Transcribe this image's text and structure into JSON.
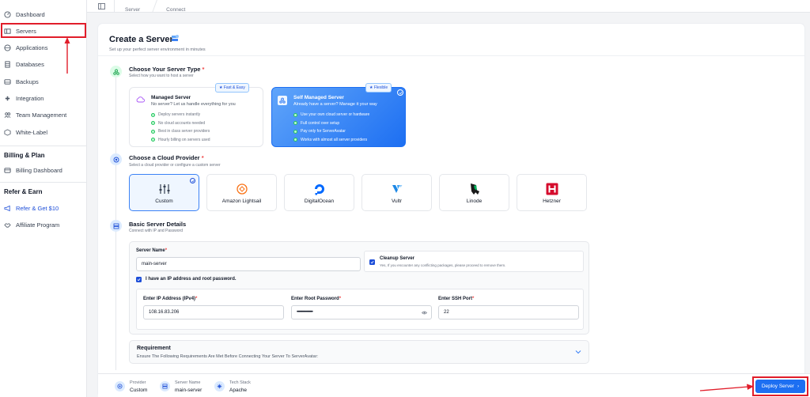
{
  "sidebar": {
    "items": [
      {
        "label": "Dashboard",
        "icon": "dashboard-icon"
      },
      {
        "label": "Servers",
        "icon": "server-icon"
      },
      {
        "label": "Applications",
        "icon": "globe-icon"
      },
      {
        "label": "Databases",
        "icon": "database-icon"
      },
      {
        "label": "Backups",
        "icon": "backup-icon"
      },
      {
        "label": "Integration",
        "icon": "integration-icon"
      },
      {
        "label": "Team Management",
        "icon": "team-icon"
      },
      {
        "label": "White-Label",
        "icon": "whitelabel-icon"
      }
    ],
    "billing_heading": "Billing & Plan",
    "billing_dashboard": "Billing Dashboard",
    "refer_heading": "Refer & Earn",
    "refer_get": "Refer & Get $10",
    "affiliate": "Affiliate Program"
  },
  "breadcrumb": {
    "server": "Server",
    "connect": "Connect"
  },
  "page": {
    "title": "Create a Server",
    "subtitle": "Set up your perfect server environment in minutes"
  },
  "step1": {
    "title": "Choose Your Server Type",
    "subtitle": "Select how you want to host a server",
    "managed": {
      "badge": "★ Fast & Easy",
      "title": "Managed Server",
      "desc": "No server? Let us handle everything for you",
      "features": [
        "Deploy servers instantly",
        "No cloud accounts needed",
        "Best in class server providers",
        "Hourly billing on servers used"
      ]
    },
    "self": {
      "badge": "★ Flexible",
      "title": "Self Managed Server",
      "desc": "Already have a server? Manage it your way",
      "features": [
        "Use your own cloud server or hardware",
        "Full control over setup",
        "Pay only for ServerAvatar",
        "Works with almost all server providers"
      ]
    }
  },
  "step2": {
    "title": "Choose a Cloud Provider",
    "subtitle": "Select a cloud provider or configure a custom server",
    "providers": [
      "Custom",
      "Amazon Lightsail",
      "DigitalOcean",
      "Vultr",
      "Linode",
      "Hetzner"
    ]
  },
  "step3": {
    "title": "Basic Server Details",
    "subtitle": "Connect with IP and Password",
    "server_name_label": "Server Name",
    "server_name_value": "main-server",
    "cleanup_title": "Cleanup Server",
    "cleanup_desc": "Yes, If you encounter any conflicting packages, please proceed to remove them.",
    "ip_checkbox": "I have an IP address and root password.",
    "ip_label": "Enter IP Address (IPv4)",
    "ip_value": "108.16.83.206",
    "pw_label": "Enter Root Password",
    "pw_value": "••••••••••••••••••",
    "port_label": "Enter SSH Port",
    "port_value": "22",
    "req_title": "Requirement",
    "req_desc": "Ensure The Following Requirements Are Met Before Connecting Your Server To ServerAvatar:"
  },
  "footer": {
    "provider_label": "Provider",
    "provider_value": "Custom",
    "name_label": "Server Name",
    "name_value": "main-server",
    "stack_label": "Tech Stack",
    "stack_value": "Apache",
    "deploy": "Deploy Server",
    "deploy_chevron": "›"
  },
  "colors": {
    "primary": "#1d6ff2",
    "highlight": "#e11d2a"
  }
}
